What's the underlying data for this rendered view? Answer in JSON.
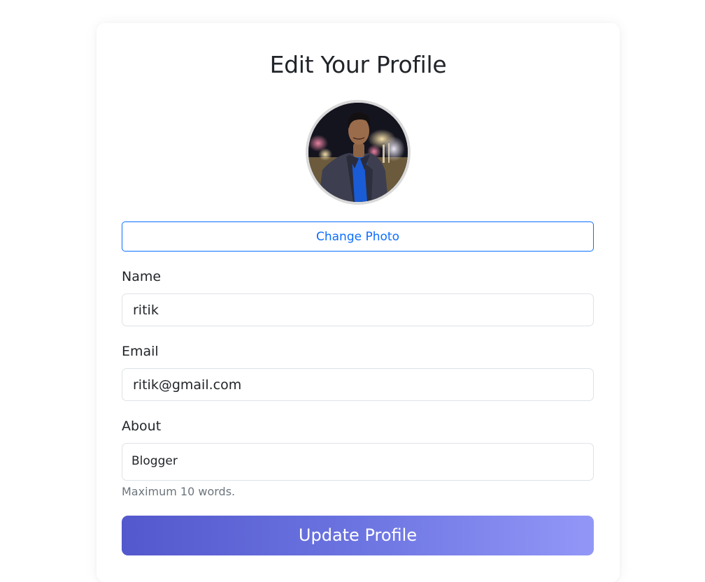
{
  "page": {
    "title": "Edit Your Profile"
  },
  "avatar": {
    "icon": "profile-photo"
  },
  "photo": {
    "button_label": "Change Photo"
  },
  "form": {
    "name_label": "Name",
    "name_value": "ritik",
    "email_label": "Email",
    "email_value": "ritik@gmail.com",
    "about_label": "About",
    "about_value": "Blogger",
    "about_help": "Maximum 10 words.",
    "submit_label": "Update Profile"
  },
  "colors": {
    "primary_outline": "#0d6efd",
    "gradient_start": "#5358cc",
    "gradient_end": "#9297f7",
    "muted_text": "#6c757d"
  }
}
